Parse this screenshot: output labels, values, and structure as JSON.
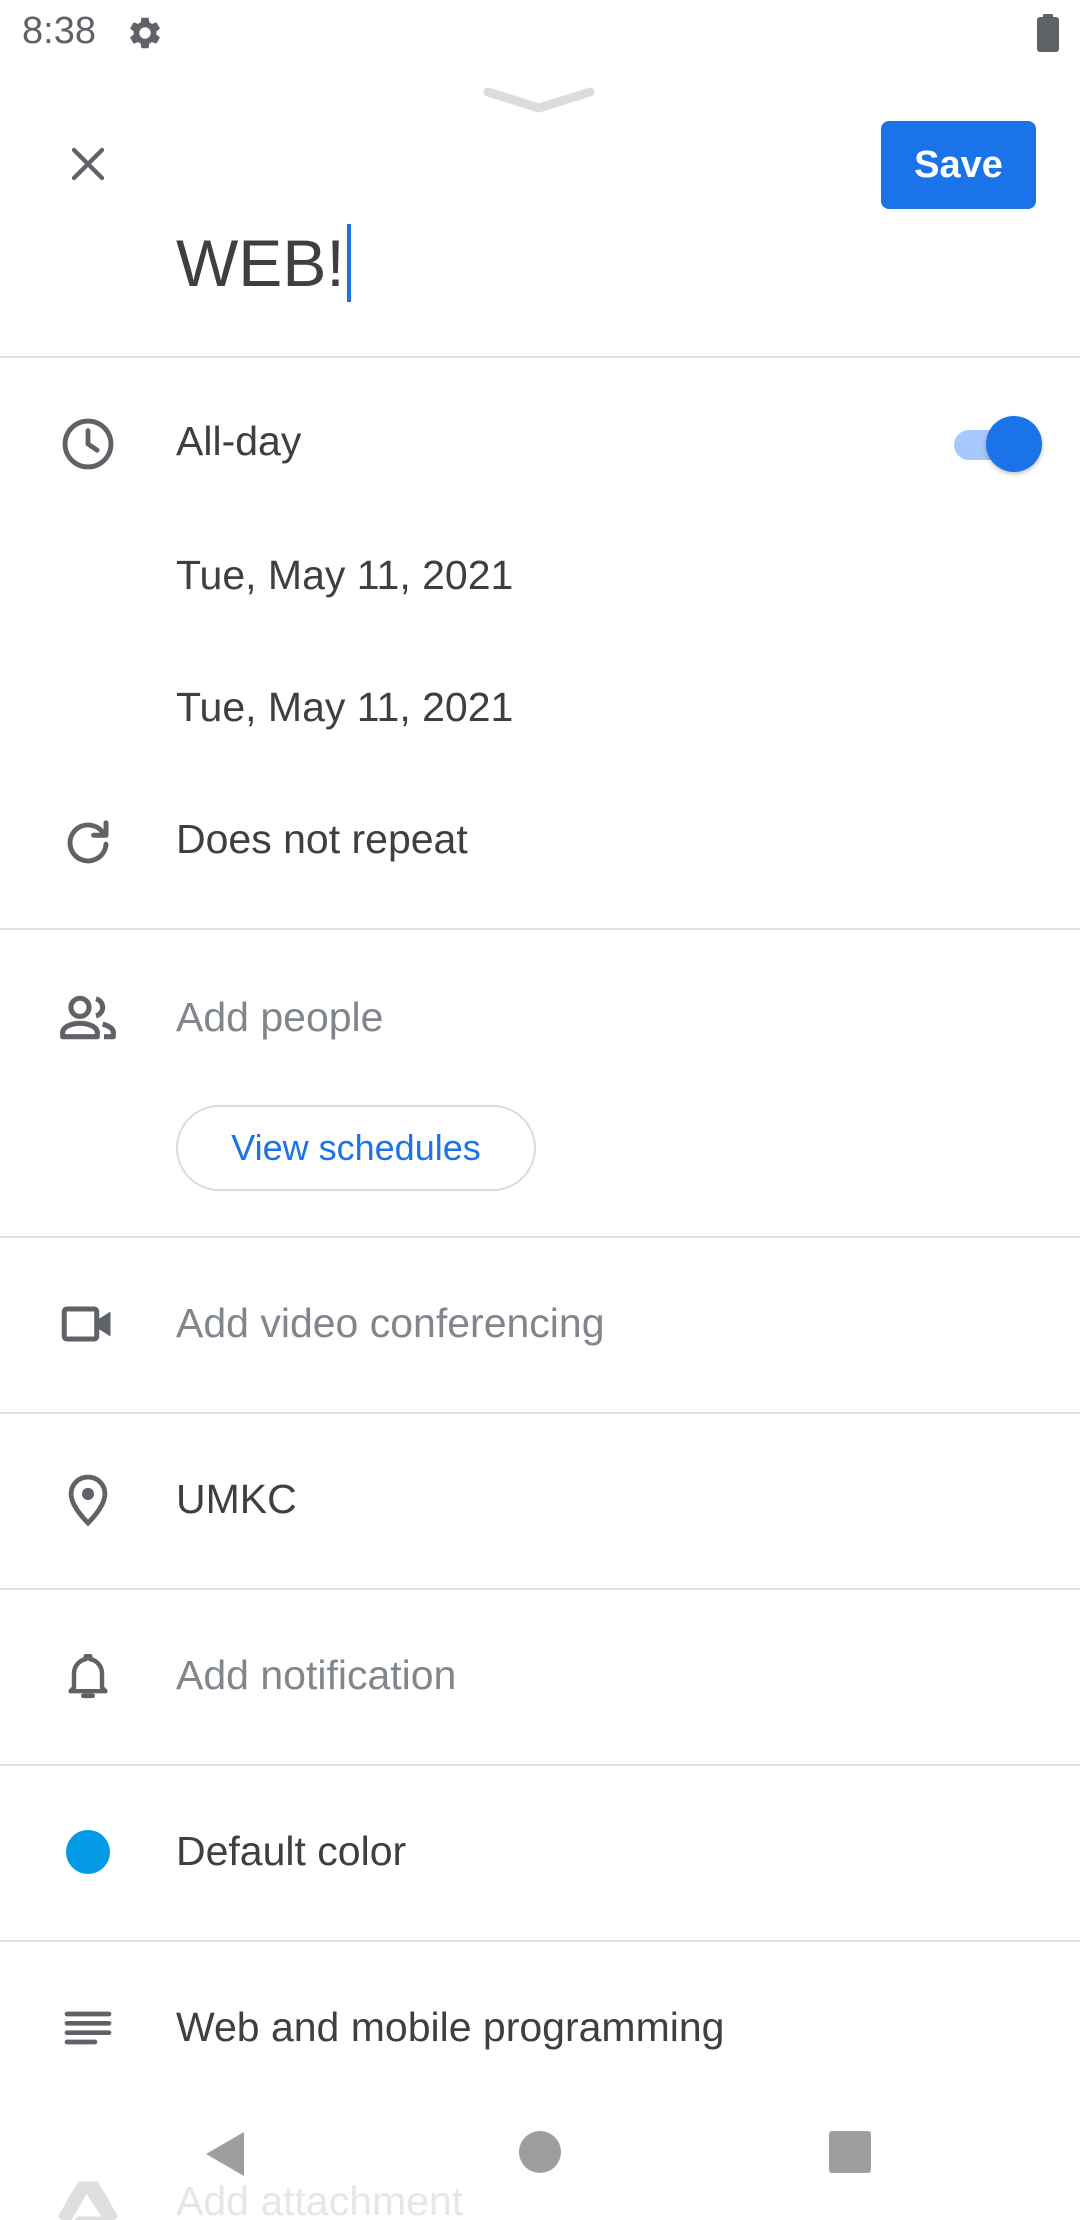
{
  "status_bar": {
    "time": "8:38",
    "settings_icon": "gear-icon",
    "battery_icon": "battery-icon"
  },
  "header": {
    "close_icon": "close-icon",
    "save_label": "Save",
    "title_value": "WEB!"
  },
  "all_day": {
    "icon": "clock-icon",
    "label": "All-day",
    "toggle_on": true
  },
  "dates": {
    "start": "Tue, May 11, 2021",
    "end": "Tue, May 11, 2021"
  },
  "repeat": {
    "icon": "repeat-icon",
    "label": "Does not repeat"
  },
  "people": {
    "icon": "people-icon",
    "placeholder": "Add people",
    "view_schedules_label": "View schedules"
  },
  "video": {
    "icon": "video-camera-icon",
    "placeholder": "Add video conferencing"
  },
  "location": {
    "icon": "location-pin-icon",
    "value": "UMKC"
  },
  "notification": {
    "icon": "bell-icon",
    "placeholder": "Add notification"
  },
  "color": {
    "label": "Default color",
    "swatch": "#039be5"
  },
  "description": {
    "icon": "notes-icon",
    "value": "Web and mobile programming"
  },
  "attachment": {
    "icon": "drive-icon",
    "placeholder": "Add attachment"
  },
  "nav_bar": {
    "back_icon": "back-icon",
    "home_icon": "home-icon",
    "recents_icon": "recents-icon"
  },
  "colors": {
    "accent": "#1a73e8",
    "toggle_track": "#a8c7fa",
    "text_primary": "#3c4043",
    "text_hint": "#80868b",
    "divider": "#e0e0e0"
  }
}
